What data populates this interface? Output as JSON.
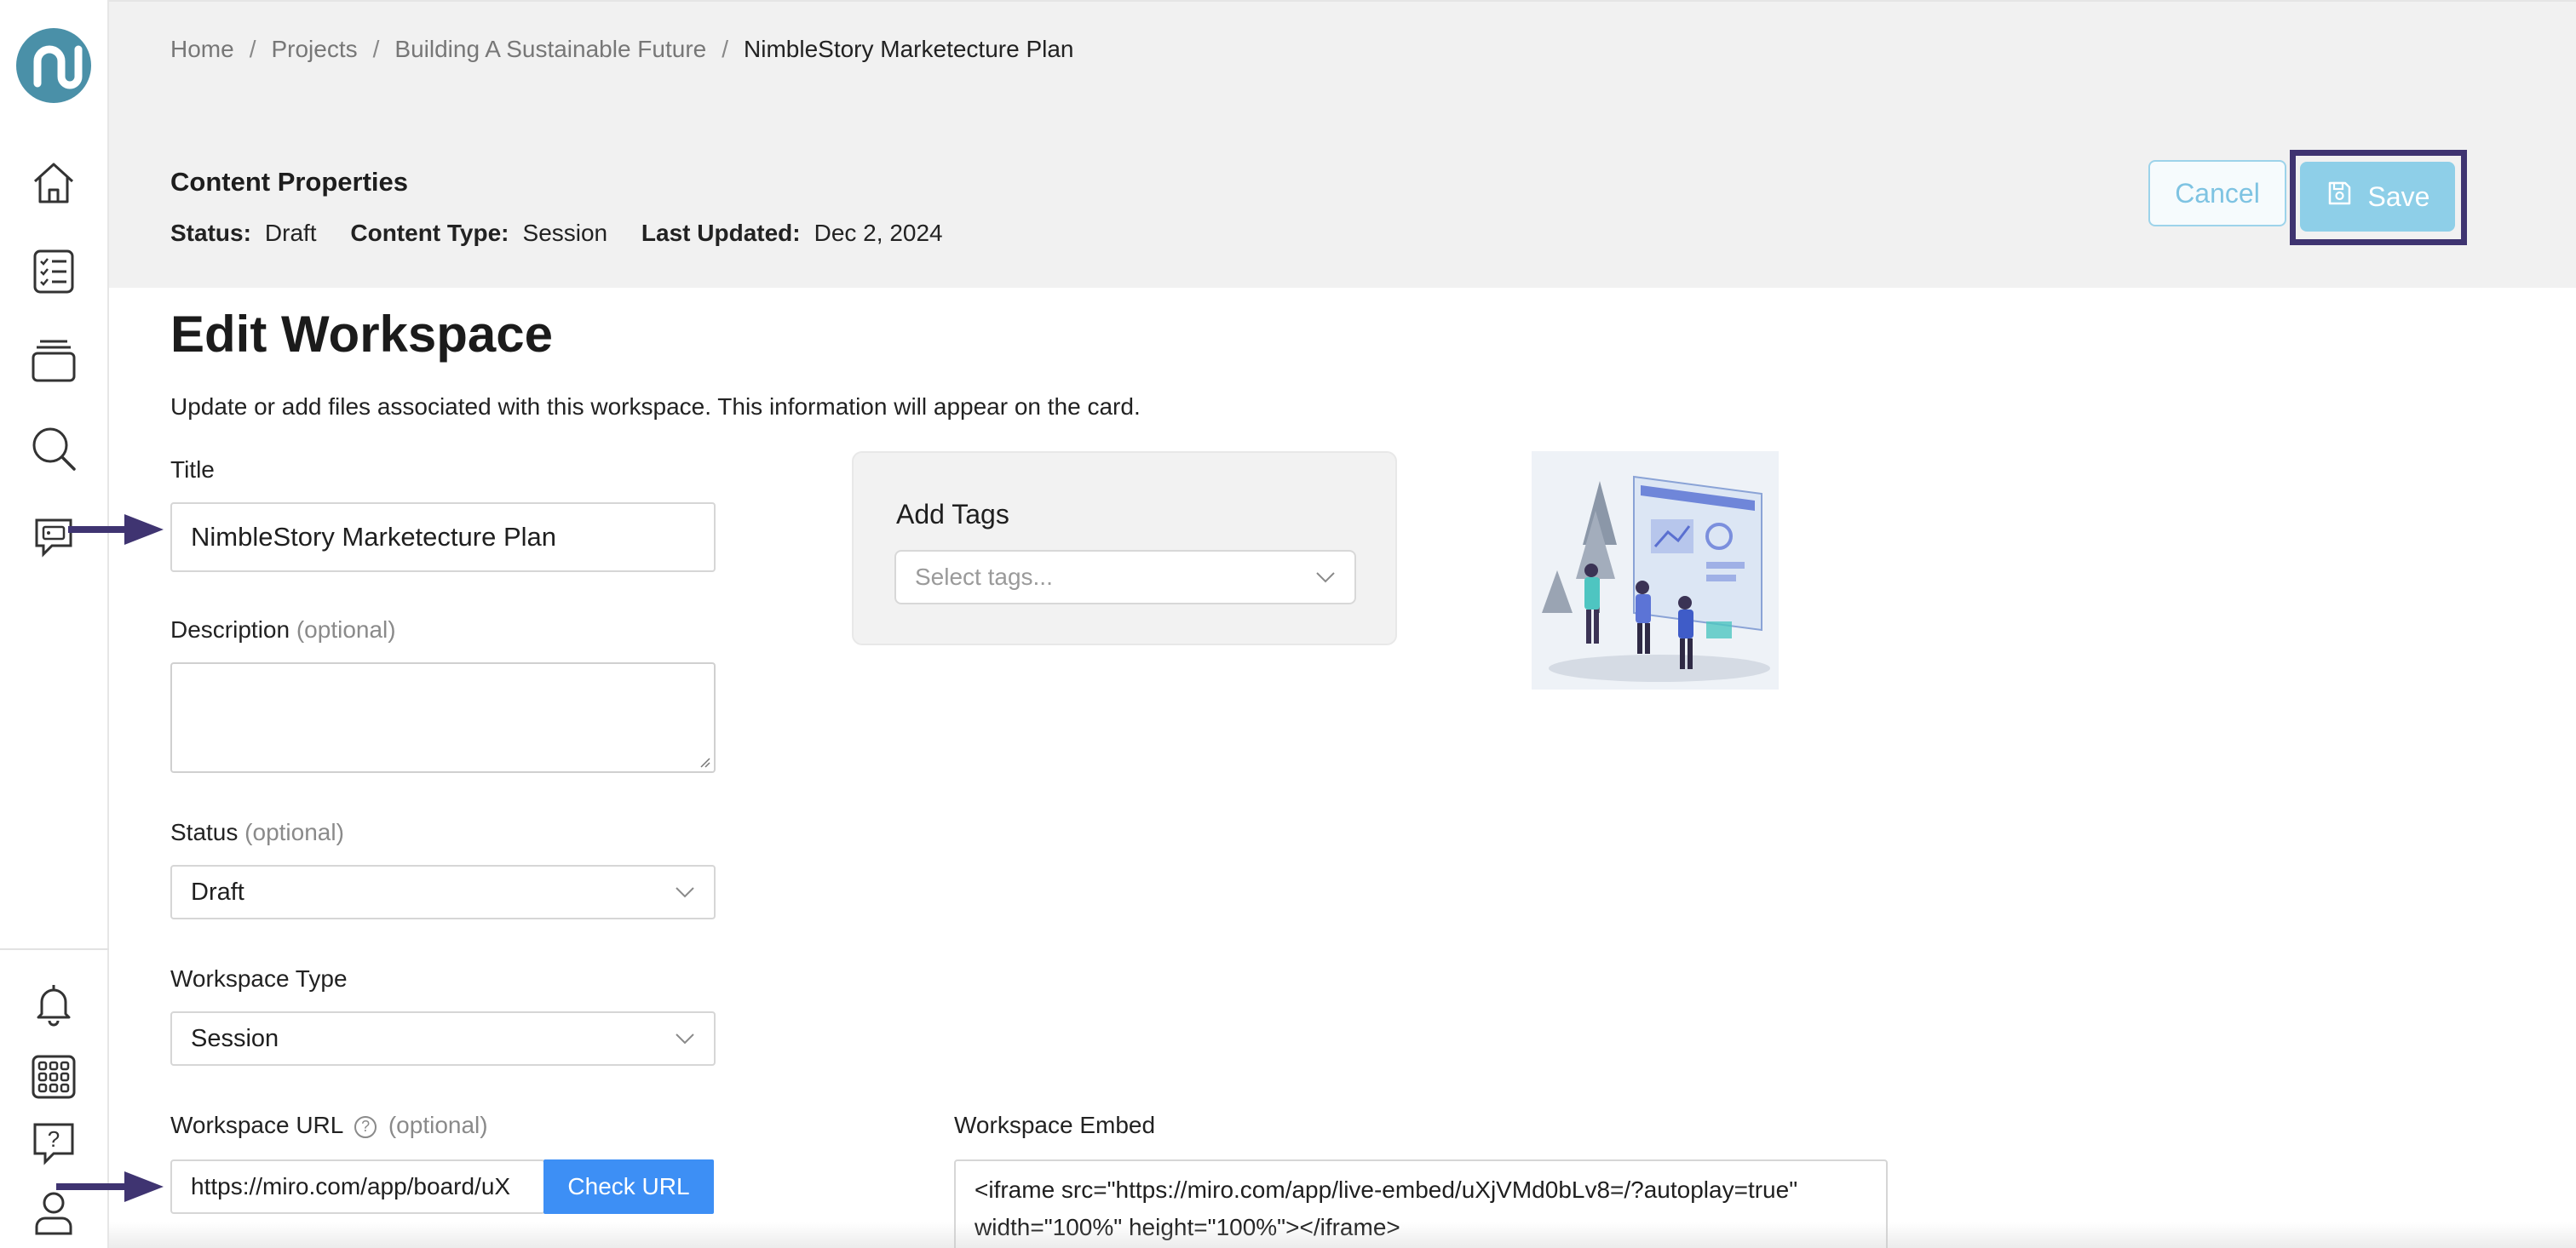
{
  "breadcrumb": {
    "items": [
      "Home",
      "Projects",
      "Building A Sustainable Future"
    ],
    "separator": "/",
    "current": "NimbleStory Marketecture Plan"
  },
  "properties": {
    "title": "Content Properties",
    "status_label": "Status:",
    "status_value": "Draft",
    "type_label": "Content Type:",
    "type_value": "Session",
    "updated_label": "Last Updated:",
    "updated_value": "Dec 2, 2024"
  },
  "actions": {
    "cancel": "Cancel",
    "save": "Save"
  },
  "page": {
    "title": "Edit Workspace",
    "subtitle": "Update or add files associated with this workspace. This information will appear on the card."
  },
  "form": {
    "title_label": "Title",
    "title_value": "NimbleStory Marketecture Plan",
    "description_label": "Description",
    "optional": "(optional)",
    "status_label": "Status",
    "status_value": "Draft",
    "workspace_type_label": "Workspace Type",
    "workspace_type_value": "Session",
    "url_label": "Workspace URL",
    "url_help": "?",
    "url_value": "https://miro.com/app/board/uX",
    "check_url": "Check URL",
    "embed_label": "Workspace Embed",
    "embed_line1": "<iframe src=\"https://miro.com/app/live-embed/uXjVMd0bLv8=/?autoplay=true\"",
    "embed_line2": "width=\"100%\" height=\"100%\"></iframe>"
  },
  "tags": {
    "title": "Add Tags",
    "placeholder": "Select tags..."
  },
  "sidebar": {
    "icons": [
      "home-icon",
      "checklist-icon",
      "stack-icon",
      "search-icon",
      "chat-card-icon",
      "bell-icon",
      "apps-grid-icon",
      "help-icon",
      "user-icon"
    ]
  },
  "colors": {
    "accent": "#3d8ff5",
    "save_bg": "#8ecfe8",
    "highlight": "#3f3471",
    "header_bg": "#f1f1f1"
  }
}
